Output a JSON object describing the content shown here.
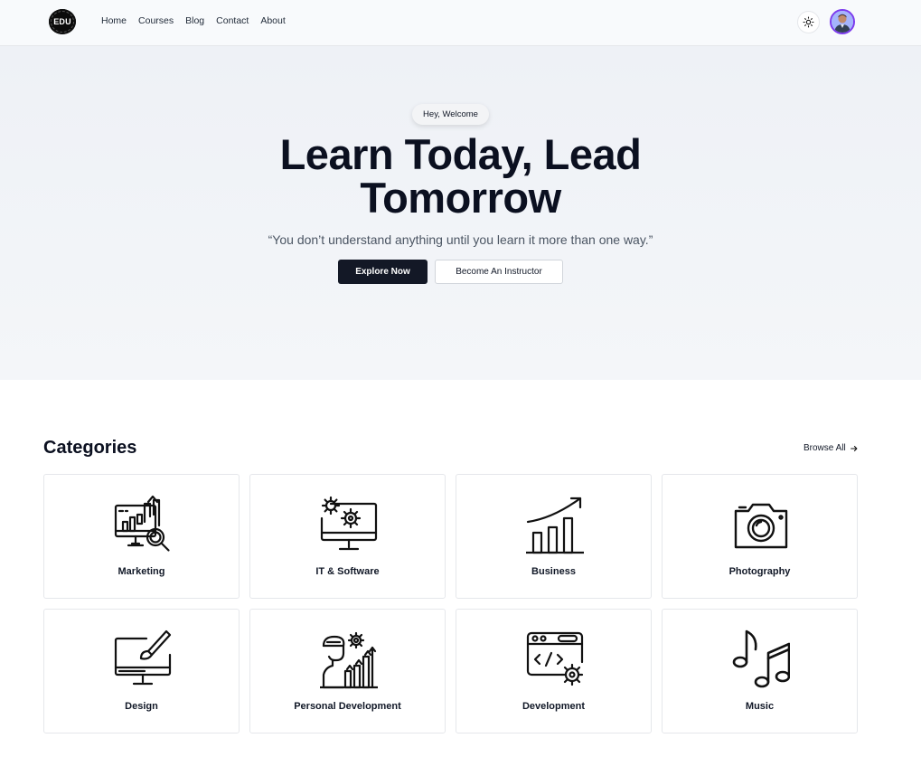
{
  "nav": {
    "logo_text": "EDU",
    "links": [
      "Home",
      "Courses",
      "Blog",
      "Contact",
      "About"
    ]
  },
  "hero": {
    "badge": "Hey, Welcome",
    "title_line1": "Learn Today, Lead",
    "title_line2": "Tomorrow",
    "quote": "“You don’t understand anything until you learn it more than one way.”",
    "primary_button": "Explore Now",
    "secondary_button": "Become An Instructor"
  },
  "categories": {
    "heading": "Categories",
    "browse_all": "Browse All",
    "items": [
      {
        "label": "Marketing",
        "icon": "marketing-icon"
      },
      {
        "label": "IT & Software",
        "icon": "it-software-icon"
      },
      {
        "label": "Business",
        "icon": "business-icon"
      },
      {
        "label": "Photography",
        "icon": "camera-icon"
      },
      {
        "label": "Design",
        "icon": "design-icon"
      },
      {
        "label": "Personal Development",
        "icon": "personal-development-icon"
      },
      {
        "label": "Development",
        "icon": "development-icon"
      },
      {
        "label": "Music",
        "icon": "music-icon"
      }
    ]
  },
  "colors": {
    "primary_button_bg": "#131826",
    "avatar_ring": "#7c3aed",
    "hero_bg": "#eef1f6"
  }
}
